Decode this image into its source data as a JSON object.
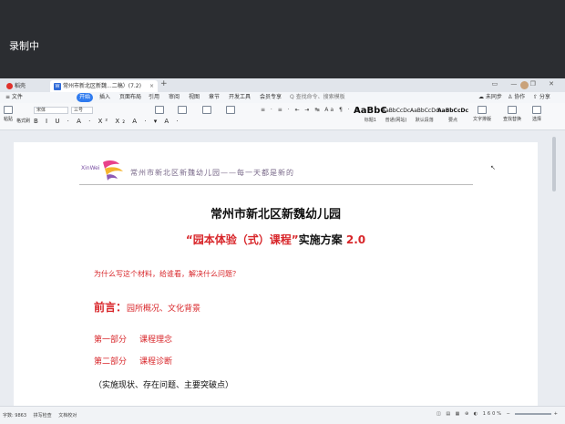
{
  "recording": {
    "label": "录制中"
  },
  "tabs": {
    "home": "稻壳",
    "document": "常州市新北区新魏...二稿）(7.2)",
    "document_close": "×",
    "new_tab": "+"
  },
  "window": {
    "controls": "▭ — ❐ ✕"
  },
  "menu": {
    "items": [
      "≡ 文件",
      "开始",
      "插入",
      "页面布局",
      "引用",
      "审阅",
      "视图",
      "章节",
      "开发工具",
      "会员专享"
    ],
    "active_index": 1,
    "search_placeholder": "Q 查找命令、搜索模板",
    "unsynced": "☁ 未同步",
    "collab": "♙ 协作",
    "share": "⇧ 分享"
  },
  "ribbon": {
    "paste": "粘贴",
    "format_painter": "格式刷",
    "font_name": "宋体",
    "font_size": "三号",
    "format_buttons": "B I U · A · X² X₂ A · ▾ A ·",
    "para_buttons": "≡ · ≡ · ⇤ ⇥ ↹ Aa ¶ · ⊞",
    "styles": [
      {
        "sample": "AaBbC",
        "name": "标题1"
      },
      {
        "sample": "AaBbCcDc",
        "name": "普通(网站)"
      },
      {
        "sample": "AaBbCcDd",
        "name": "默认段落"
      },
      {
        "sample": "AaBbCcDc",
        "name": "要点"
      }
    ],
    "text_tools": "文字排版",
    "find_replace": "查找替换",
    "select": "选择"
  },
  "document": {
    "header_text": "常州市新北区新魏幼儿园——每一天都是新的",
    "logo_caption": "XinWei",
    "title": "常州市新北区新魏幼儿园",
    "subtitle_red": "“园本体验（式）课程”",
    "subtitle_black": "实施方案",
    "subtitle_version": "2.0",
    "question": "为什么写这个材料，给谁看，解决什么问题？",
    "preface_lead": "前言：",
    "preface_rest": "园所概况、文化背景",
    "part1_num": "第一部分",
    "part1_title": "课程理念",
    "part2_num": "第二部分",
    "part2_title": "课程诊断",
    "detail": "（实施现状、存在问题、主要突破点）"
  },
  "status": {
    "word_count": "字数: 9863",
    "spell_check": "拼写检查",
    "doc_check": "文档校对",
    "zoom": "160%"
  }
}
